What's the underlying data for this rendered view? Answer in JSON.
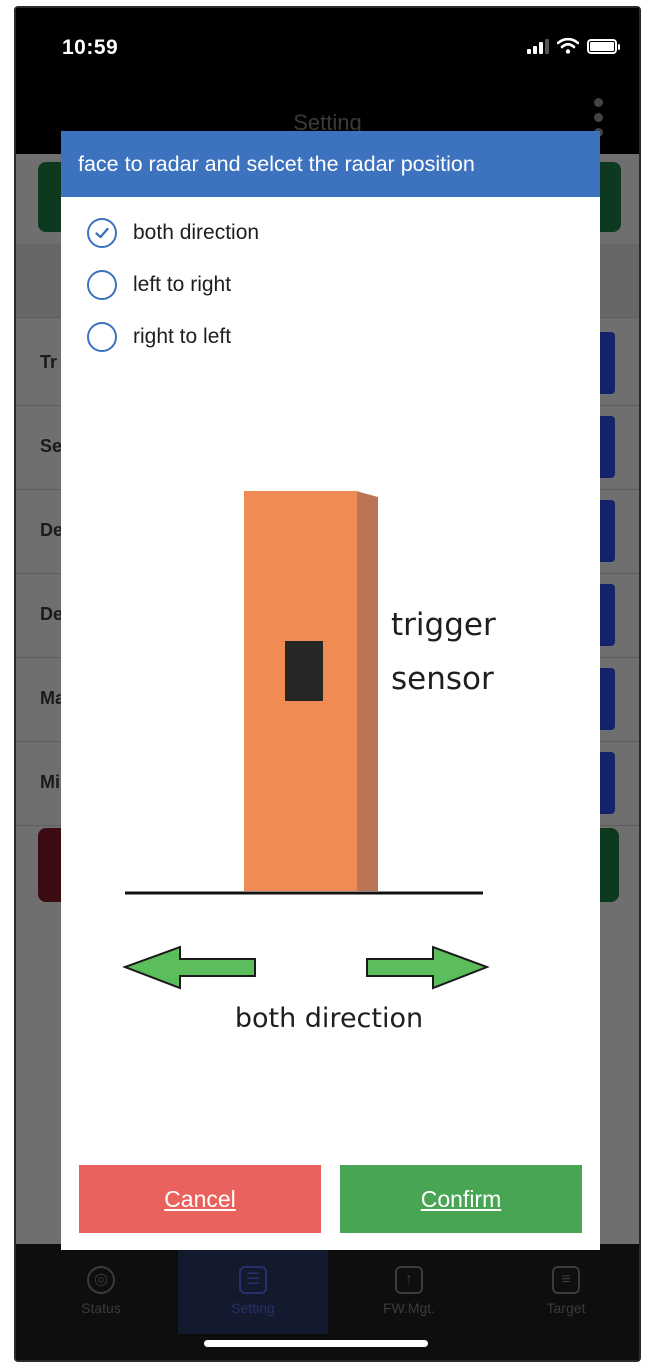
{
  "status_bar": {
    "time": "10:59"
  },
  "navbar": {
    "title": "Setting"
  },
  "background_rows": [
    {
      "label": "Tr"
    },
    {
      "label": "Se"
    },
    {
      "label": "De"
    },
    {
      "label": "De"
    },
    {
      "label": "Ma"
    },
    {
      "label": "Mi"
    }
  ],
  "dialog": {
    "title": "face to radar and selcet the radar position",
    "options": [
      {
        "label": "both direction",
        "selected": true
      },
      {
        "label": "left to right",
        "selected": false
      },
      {
        "label": "right to left",
        "selected": false
      }
    ],
    "illustration": {
      "sensor_label_line1": "trigger",
      "sensor_label_line2": "sensor",
      "caption": "both direction",
      "colors": {
        "sensor_front": "#f08b53",
        "sensor_side": "#b97556",
        "arrow_fill": "#5cbd5c",
        "arrow_stroke": "#1a1a1a"
      }
    },
    "cancel_label": "Cancel",
    "confirm_label": "Confirm"
  },
  "tabbar": {
    "tabs": [
      {
        "label": "Status",
        "icon": "radar-icon"
      },
      {
        "label": "Setting",
        "icon": "settings-list-icon",
        "active": true
      },
      {
        "label": "FW.Mgt.",
        "icon": "firmware-upload-icon"
      },
      {
        "label": "Target",
        "icon": "message-icon"
      }
    ]
  },
  "colors": {
    "accent": "#3d72be",
    "cancel": "#ea625d",
    "confirm": "#48a553"
  }
}
